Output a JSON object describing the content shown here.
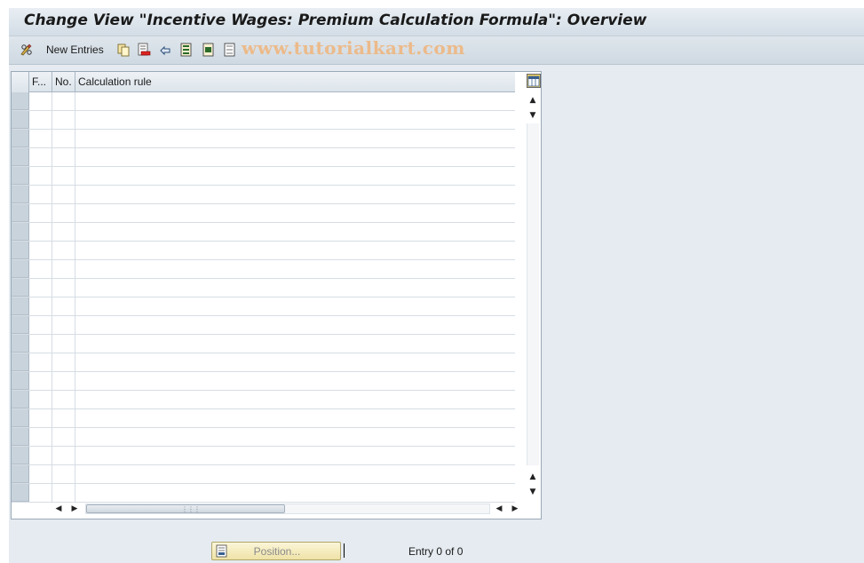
{
  "window": {
    "title": "Change View \"Incentive Wages: Premium Calculation Formula\": Overview"
  },
  "toolbar": {
    "new_entries_label": "New Entries",
    "icons": [
      "change-display-icon",
      "copy-icon",
      "delete-icon",
      "undo-icon",
      "select-all-icon",
      "select-block-icon",
      "deselect-all-icon"
    ],
    "watermark": "www.tutorialkart.com"
  },
  "table": {
    "columns": [
      "F...",
      "No.",
      "Calculation rule"
    ],
    "row_count": 22,
    "rows": []
  },
  "footer": {
    "position_label": "Position...",
    "entry_status": "Entry 0 of 0"
  },
  "colors": {
    "title_bg": "#dfe6ec",
    "grid_row_selector": "#c9d3dc",
    "position_button": "#f5ecbf"
  }
}
